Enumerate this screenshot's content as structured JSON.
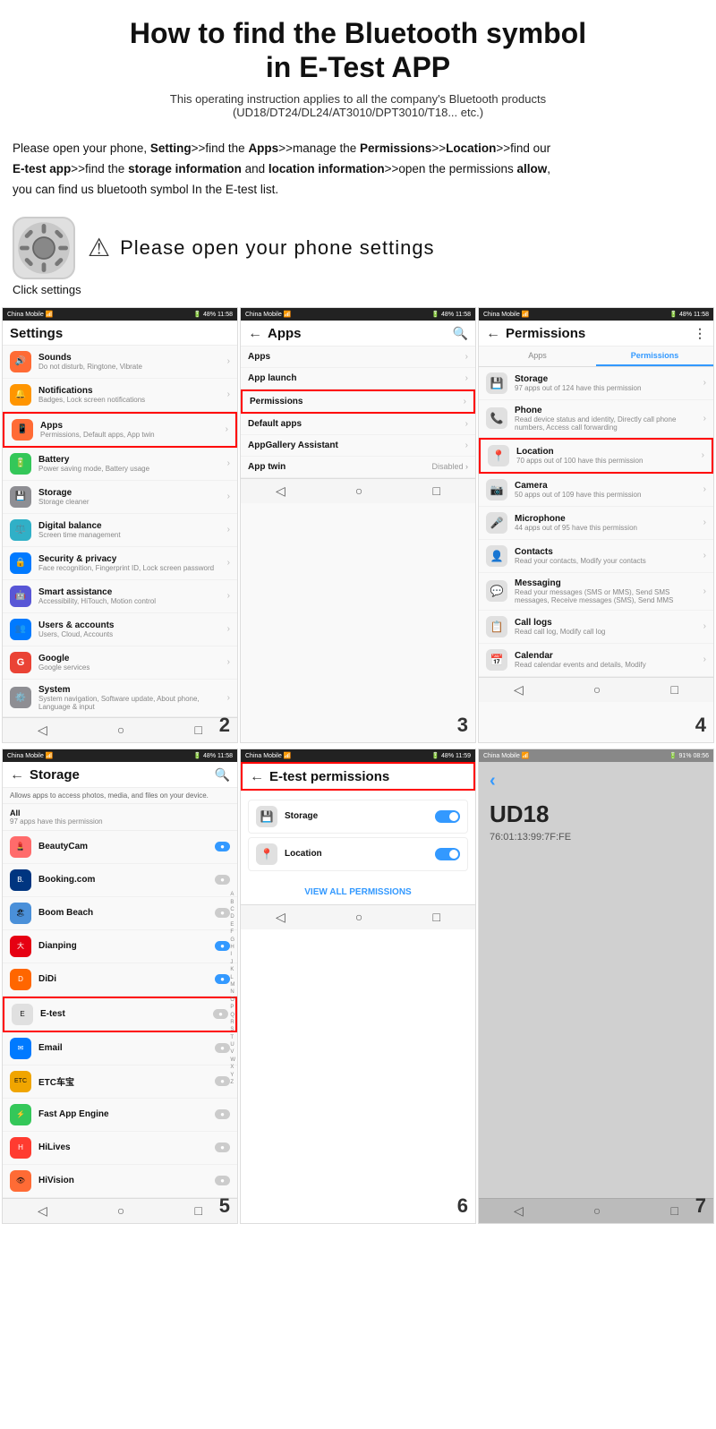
{
  "header": {
    "title": "How to find the Bluetooth symbol\nin E-Test APP",
    "subtitle": "This operating instruction applies to all the company's Bluetooth products\n(UD18/DT24/DL24/AT3010/DPT3010/T18... etc.)"
  },
  "instructions": {
    "line1": "Please open your phone, Setting>>find the Apps>>manage the Permissions>>Location>>find our",
    "line2": "E-test app>>find the storage information and location information>>open the permissions allow,",
    "line3": "you can find us bluetooth symbol In the E-test list."
  },
  "step_intro": {
    "warning": "⚠",
    "text": "Please open your phone settings",
    "click_label": "Click settings"
  },
  "screen1": {
    "title": "Settings",
    "status": "China Mobile  48%  11:58",
    "items": [
      {
        "icon": "🔊",
        "color": "#ff6b35",
        "title": "Sounds",
        "sub": "Do not disturb, Ringtone, Vibrate"
      },
      {
        "icon": "🔔",
        "color": "#ff9500",
        "title": "Notifications",
        "sub": "Badges, Lock screen notifications"
      },
      {
        "icon": "📱",
        "color": "#ff6b35",
        "title": "Apps",
        "sub": "Permissions, Default apps, App twin",
        "highlight": true
      },
      {
        "icon": "🔋",
        "color": "#34c759",
        "title": "Battery",
        "sub": "Power saving mode, Battery usage"
      },
      {
        "icon": "💾",
        "color": "#8e8e93",
        "title": "Storage",
        "sub": "Storage cleaner"
      },
      {
        "icon": "⚖️",
        "color": "#30b0c7",
        "title": "Digital balance",
        "sub": "Screen time management"
      },
      {
        "icon": "🔒",
        "color": "#007aff",
        "title": "Security & privacy",
        "sub": "Face recognition, Fingerprint ID, Lock screen password"
      },
      {
        "icon": "🤖",
        "color": "#5856d6",
        "title": "Smart assistance",
        "sub": "Accessibility, HiTouch, Motion control"
      },
      {
        "icon": "👥",
        "color": "#007aff",
        "title": "Users & accounts",
        "sub": "Users, Cloud, Accounts"
      },
      {
        "icon": "G",
        "color": "#ea4335",
        "title": "Google",
        "sub": "Google services"
      },
      {
        "icon": "⚙️",
        "color": "#8e8e93",
        "title": "System",
        "sub": "System navigation, Software update, About phone, Language & input"
      }
    ],
    "number": "2"
  },
  "screen2": {
    "title": "Apps",
    "status": "China Mobile  48%  11:58",
    "items": [
      {
        "title": "Apps",
        "highlight": false
      },
      {
        "title": "App launch",
        "highlight": false
      },
      {
        "title": "Permissions",
        "highlight": true
      },
      {
        "title": "Default apps",
        "highlight": false
      },
      {
        "title": "AppGallery Assistant",
        "highlight": false
      },
      {
        "title": "App twin",
        "value": "Disabled",
        "highlight": false
      }
    ],
    "number": "3"
  },
  "screen3": {
    "title": "Permissions",
    "status": "China Mobile  48%  11:58",
    "tabs": [
      "Apps",
      "Permissions"
    ],
    "active_tab": "Permissions",
    "items": [
      {
        "icon": "💾",
        "title": "Storage",
        "sub": "97 apps out of 124 have this permission"
      },
      {
        "icon": "📞",
        "title": "Phone",
        "sub": "Read device status and identity, Directly call phone numbers, Access call forwarding"
      },
      {
        "icon": "📍",
        "title": "Location",
        "sub": "70 apps out of 100 have this permission",
        "highlight": true
      },
      {
        "icon": "📷",
        "title": "Camera",
        "sub": "50 apps out of 109 have this permission"
      },
      {
        "icon": "🎤",
        "title": "Microphone",
        "sub": "44 apps out of 95 have this permission"
      },
      {
        "icon": "👤",
        "title": "Contacts",
        "sub": "Read your contacts, Modify your contacts"
      },
      {
        "icon": "💬",
        "title": "Messaging",
        "sub": "Read your messages (SMS or MMS), Send SMS messages, Receive messages (SMS), Send MMS"
      },
      {
        "icon": "📋",
        "title": "Call logs",
        "sub": "Read call log, Modify call log"
      },
      {
        "icon": "📅",
        "title": "Calendar",
        "sub": "Read calendar events and details, Modify"
      }
    ],
    "number": "4"
  },
  "screen4": {
    "title": "Storage",
    "status": "China Mobile  48%  11:58",
    "description": "Allows apps to access photos, media, and files on your device.",
    "all_label": "All",
    "all_sub": "97 apps have this permission",
    "apps": [
      {
        "name": "BeautyCam",
        "toggle": true
      },
      {
        "name": "Booking.com",
        "toggle": false
      },
      {
        "name": "Boom Beach",
        "toggle": false
      },
      {
        "name": "Dianping",
        "toggle": true
      },
      {
        "name": "DiDi",
        "toggle": true
      },
      {
        "name": "E-test",
        "toggle": false,
        "highlight": true
      },
      {
        "name": "Email",
        "toggle": false
      },
      {
        "name": "ETC车宝",
        "toggle": false
      },
      {
        "name": "Fast App Engine",
        "toggle": false
      },
      {
        "name": "HiLives",
        "toggle": false
      },
      {
        "name": "HiVision",
        "toggle": false
      }
    ],
    "number": "5"
  },
  "screen5": {
    "title": "E-test permissions",
    "status": "China Mobile  48%  11:59",
    "items": [
      {
        "icon": "💾",
        "name": "Storage",
        "toggle": true
      },
      {
        "icon": "📍",
        "name": "Location",
        "toggle": true
      }
    ],
    "view_all": "VIEW ALL PERMISSIONS",
    "number": "6"
  },
  "screen6": {
    "title": "UD18",
    "subtitle": "76:01:13:99:7F:FE",
    "status": "91%  08:56",
    "number": "7"
  }
}
